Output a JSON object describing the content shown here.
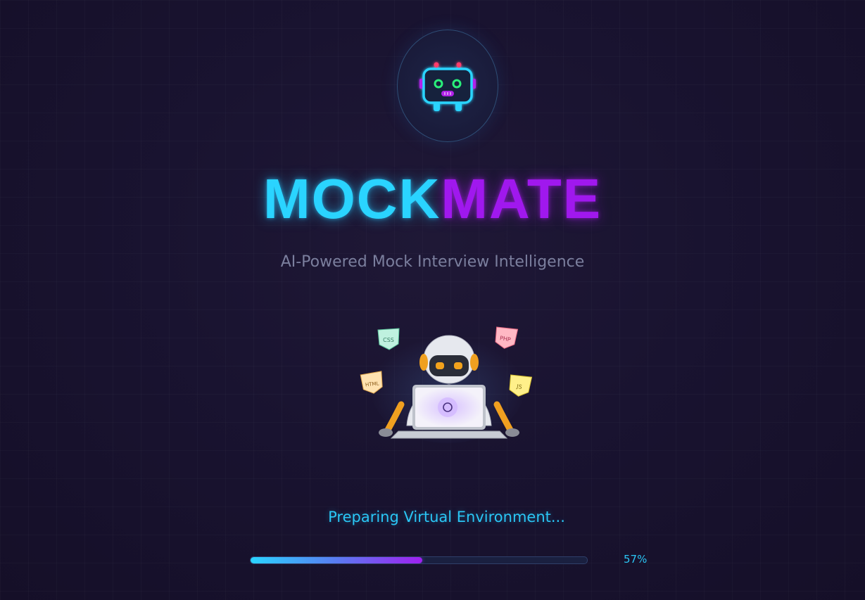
{
  "brand": {
    "part1": "MOCK",
    "part2": "MATE"
  },
  "tagline": "AI-Powered Mock Interview Intelligence",
  "status": {
    "text": "Preparing Virtual Environment...",
    "percent_label": "57%"
  },
  "progress": {
    "value": 0.51
  },
  "illustration": {
    "tags": [
      "CSS",
      "PHP",
      "HTML",
      "JS"
    ]
  },
  "colors": {
    "cyan": "#2ad4ff",
    "purple": "#a018ee",
    "background": "#1a1430"
  },
  "icons": {
    "logo": "robot-head-icon"
  }
}
